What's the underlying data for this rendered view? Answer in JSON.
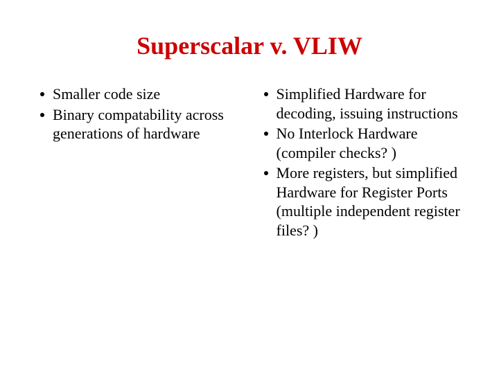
{
  "slide": {
    "title": "Superscalar v. VLIW",
    "leftColumn": {
      "items": [
        "Smaller code size",
        "Binary compatability across generations of hardware"
      ]
    },
    "rightColumn": {
      "items": [
        "Simplified Hardware for decoding, issuing instructions",
        "No Interlock Hardware (compiler checks? )",
        "More registers, but simplified Hardware for Register Ports (multiple independent register files? )"
      ]
    }
  }
}
